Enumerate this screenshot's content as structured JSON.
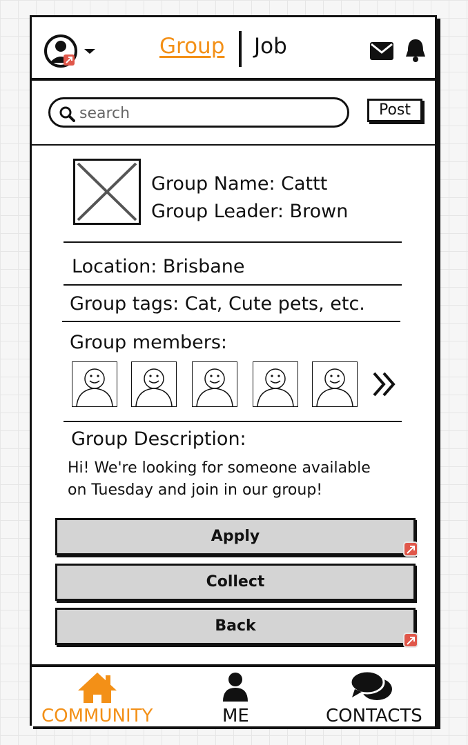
{
  "header": {
    "tabs": [
      {
        "label": "Group",
        "active": true
      },
      {
        "label": "Job",
        "active": false
      }
    ],
    "icons": [
      "avatar-icon",
      "chevron-down-icon",
      "mail-icon",
      "bell-icon"
    ]
  },
  "search": {
    "placeholder": "search",
    "post_label": "Post"
  },
  "group": {
    "name_line": "Group Name: Cattt",
    "leader_line": "Group Leader: Brown",
    "location_line": "Location: Brisbane",
    "tags_line": "Group tags: Cat, Cute pets, etc.",
    "members_label": "Group members:",
    "member_count_shown": 5,
    "description_label": "Group Description:",
    "description_lines": [
      "Hi! We're looking for someone available",
      "on Tuesday and join in our group!"
    ]
  },
  "actions": {
    "apply": "Apply",
    "collect": "Collect",
    "back": "Back"
  },
  "bottom_nav": {
    "items": [
      {
        "label": "COMMUNITY",
        "icon": "home-icon",
        "active": true
      },
      {
        "label": "ME",
        "icon": "person-icon",
        "active": false
      },
      {
        "label": "CONTACTS",
        "icon": "chat-icon",
        "active": false
      }
    ]
  },
  "colors": {
    "accent": "#f39017",
    "text": "#111111",
    "button_fill": "#d4d4d4",
    "link_badge": "#e0574a"
  }
}
